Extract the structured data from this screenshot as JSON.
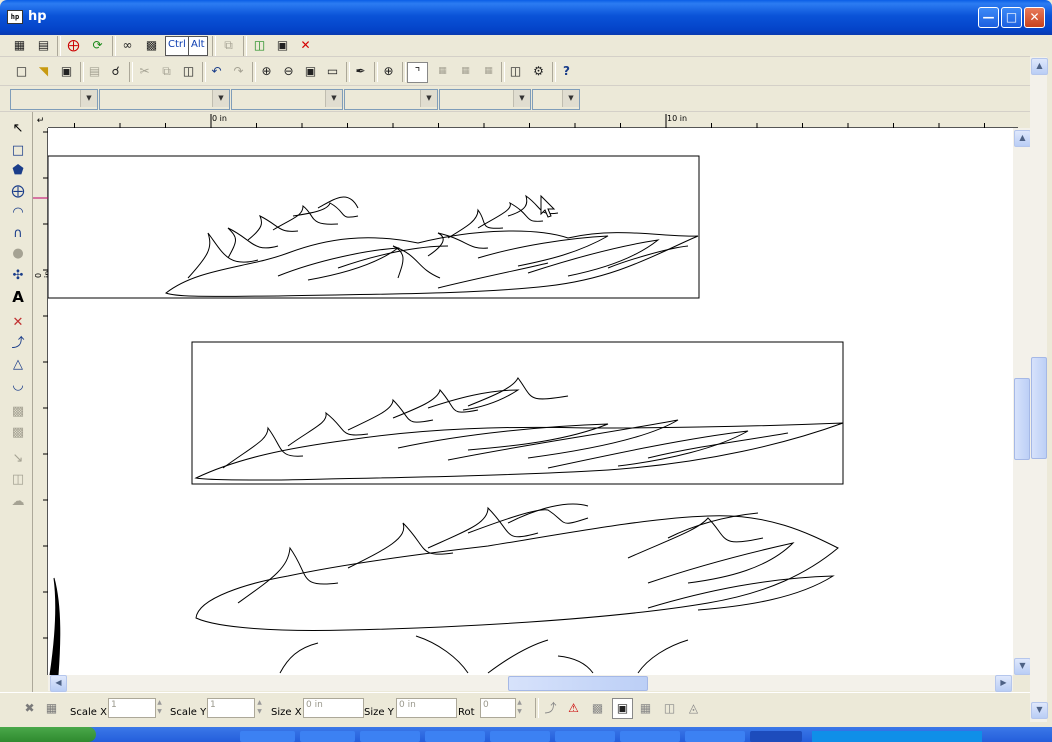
{
  "window": {
    "title": "hp",
    "app_icon_label": "hp",
    "minimize_icon": "minimize-icon",
    "maximize_icon": "maximize-icon",
    "close_icon": "close-icon"
  },
  "toolbar1": {
    "ctrl_label": "Ctrl",
    "alt_label": "Alt"
  },
  "toolbar2": {
    "help_label": "?"
  },
  "ruler": {
    "h_label_0": "0 in",
    "h_label_10": "10 in",
    "v_label_0": "0 in"
  },
  "properties": {
    "scale_x_label": "Scale X",
    "scale_x_value": "1",
    "scale_y_label": "Scale Y",
    "scale_y_value": "1",
    "size_x_label": "Size X",
    "size_x_value": "0 in",
    "size_y_label": "Size Y",
    "size_y_value": "0 in",
    "rot_label": "Rot",
    "rot_value": "0"
  },
  "colors": {
    "titlebar": "#0a53d8",
    "chrome": "#ece9d8",
    "canvas": "#ffffff",
    "delete_red": "#d40000"
  }
}
